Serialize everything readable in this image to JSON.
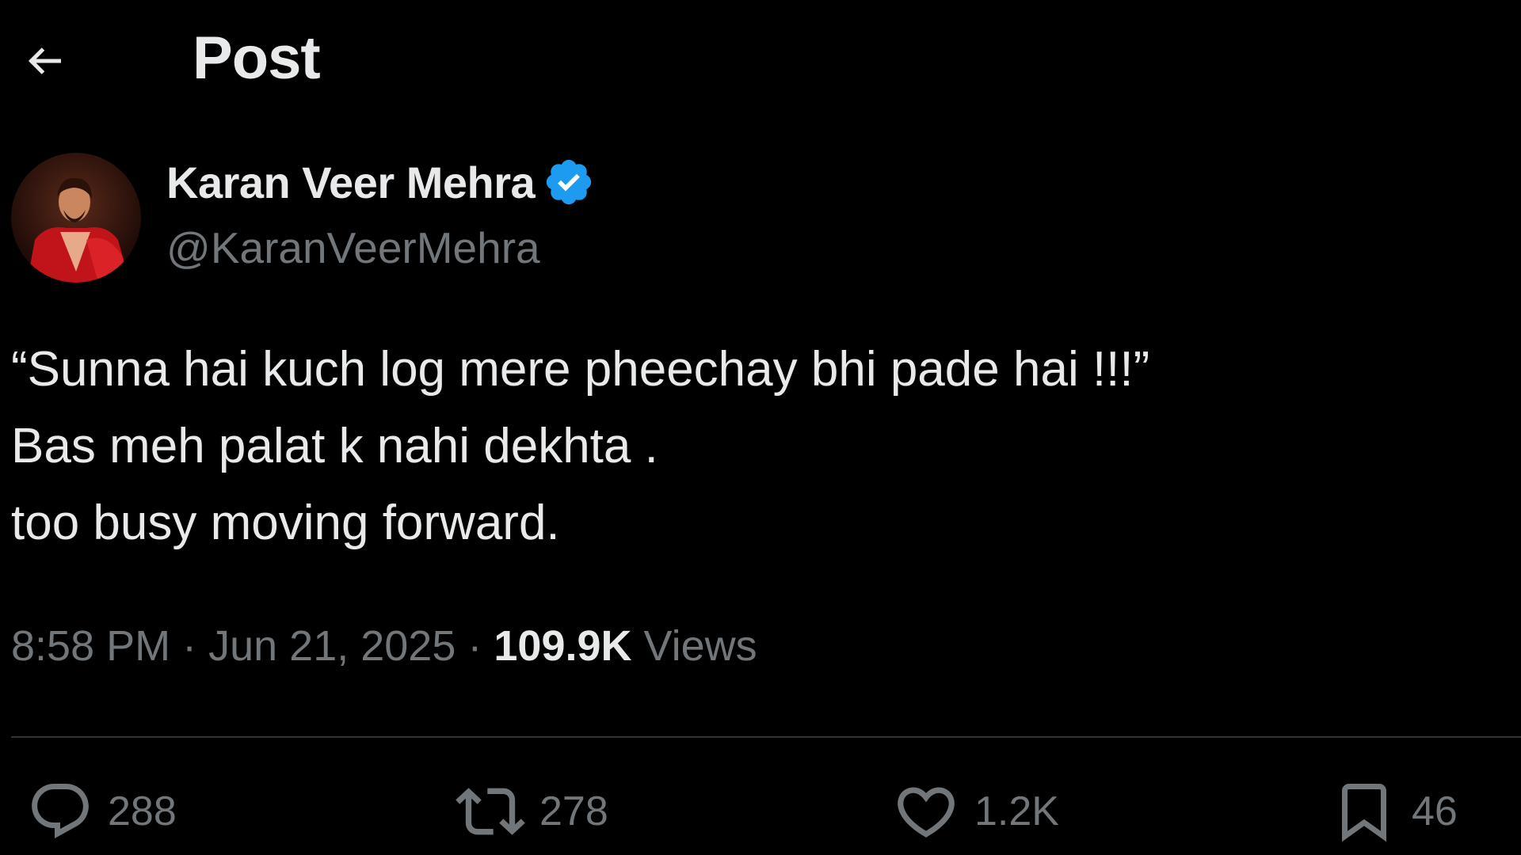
{
  "header": {
    "title": "Post",
    "back_icon": "arrow-left-icon"
  },
  "author": {
    "display_name": "Karan Veer Mehra",
    "handle": "@KaranVeerMehra",
    "verified": true,
    "verified_color": "#1d9bf0"
  },
  "post": {
    "lines": [
      "“Sunna hai kuch log mere pheechay bhi pade hai !!!”",
      "Bas meh palat k nahi dekhta .",
      "too busy moving forward."
    ]
  },
  "meta": {
    "time": "8:58 PM",
    "separator": " · ",
    "date": "Jun 21, 2025",
    "views_count": "109.9K",
    "views_label": "Views"
  },
  "actions": {
    "replies": "288",
    "reposts": "278",
    "likes": "1.2K",
    "bookmarks": "46"
  },
  "colors": {
    "background": "#000000",
    "primary_text": "#e7e9ea",
    "secondary_text": "#71767b",
    "divider": "#2f3336",
    "accent": "#1d9bf0"
  }
}
